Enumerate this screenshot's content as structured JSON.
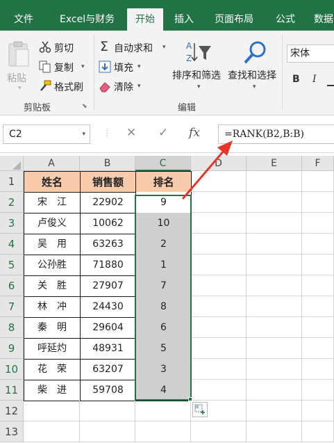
{
  "tabs": [
    {
      "label": "文件",
      "active": false
    },
    {
      "label": "Excel与财务",
      "active": false
    },
    {
      "label": "开始",
      "active": true
    },
    {
      "label": "插入",
      "active": false
    },
    {
      "label": "页面布局",
      "active": false
    },
    {
      "label": "公式",
      "active": false
    },
    {
      "label": "数据",
      "active": false
    }
  ],
  "ribbon": {
    "clipboard": {
      "paste": "粘贴",
      "cut": "剪切",
      "copy": "复制",
      "format_painter": "格式刷",
      "group_label": "剪贴板"
    },
    "editing": {
      "autosum": "自动求和",
      "fill": "填充",
      "clear": "清除",
      "sort_filter": "排序和筛选",
      "find_select": "查找和选择",
      "group_label": "编辑"
    },
    "font": {
      "font_name": "宋体",
      "bold": "B",
      "italic": "I"
    }
  },
  "formula_bar": {
    "name_box": "C2",
    "formula": "=RANK(B2,B:B)"
  },
  "sheet": {
    "columns": [
      "A",
      "B",
      "C",
      "D",
      "E",
      "F"
    ],
    "rows": [
      "1",
      "2",
      "3",
      "4",
      "5",
      "6",
      "7",
      "8",
      "9",
      "10",
      "11",
      "12",
      "13"
    ],
    "headers": [
      "姓名",
      "销售额",
      "排名"
    ],
    "data": [
      [
        "宋　江",
        "22902",
        "9"
      ],
      [
        "卢俊义",
        "10062",
        "10"
      ],
      [
        "吴　用",
        "63263",
        "2"
      ],
      [
        "公孙胜",
        "71880",
        "1"
      ],
      [
        "关　胜",
        "27907",
        "7"
      ],
      [
        "林　冲",
        "24430",
        "8"
      ],
      [
        "秦　明",
        "29604",
        "6"
      ],
      [
        "呼延灼",
        "48931",
        "5"
      ],
      [
        "花　荣",
        "63207",
        "3"
      ],
      [
        "柴　进",
        "59708",
        "4"
      ]
    ]
  },
  "colors": {
    "brand_green": "#217346",
    "header_fill": "#f8cbad",
    "selection_fill": "#cfcfcf",
    "arrow_red": "#e8352a"
  }
}
